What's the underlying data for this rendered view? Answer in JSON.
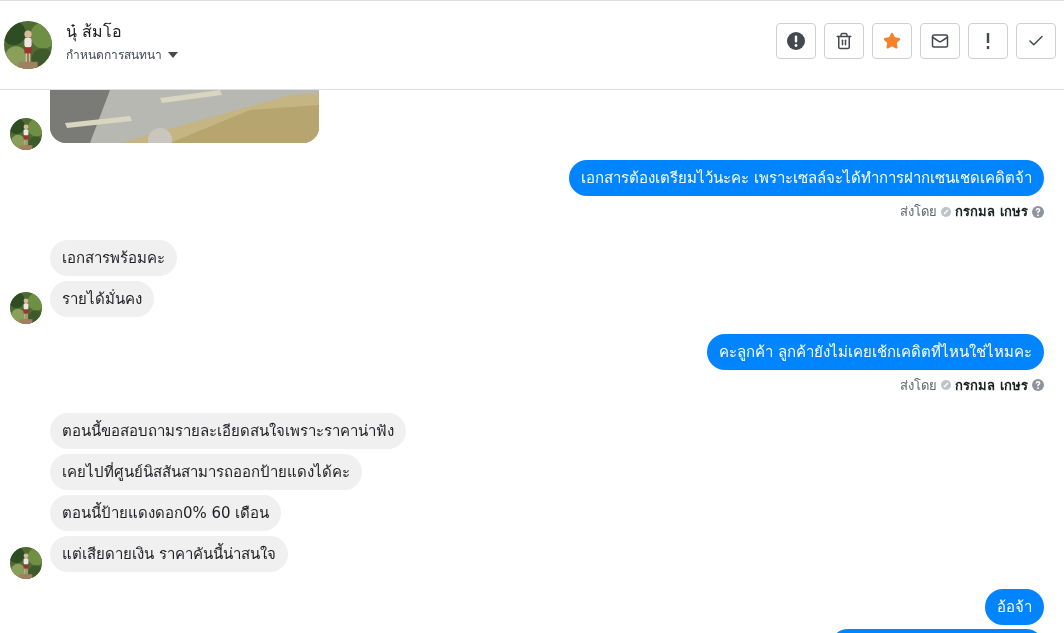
{
  "header": {
    "name": "นุ๋ ส้มโอ",
    "subtitle": "กำหนดการสนทนา"
  },
  "actions": [
    {
      "kind": "alert",
      "active": false
    },
    {
      "kind": "trash",
      "active": false
    },
    {
      "kind": "star",
      "active": true
    },
    {
      "kind": "mail",
      "active": false
    },
    {
      "kind": "bang",
      "active": false
    },
    {
      "kind": "check",
      "active": false
    }
  ],
  "groups": [
    {
      "kind": "incoming"
    },
    {
      "kind": "outgoing",
      "messages": [
        {
          "kind": "text",
          "text": "เอกสารต้องเตรียมไว้นะคะ เพราะเซลล์จะได้ทำการฝากเซนเชดเคดิตจ้า"
        }
      ],
      "sent_by": {
        "label": "ส่งโดย",
        "name": "กรกมล เกษร"
      }
    },
    {
      "kind": "incoming",
      "messages": [
        {
          "kind": "text",
          "text": "เอกสารพร้อมคะ"
        },
        {
          "kind": "text",
          "text": "รายได้มั่นคง"
        }
      ]
    },
    {
      "kind": "outgoing",
      "messages": [
        {
          "kind": "text",
          "text": "คะลูกค้า ลูกค้ายังไม่เคยเช้กเคดิตที่ไหนใช่ไหมคะ"
        }
      ],
      "sent_by": {
        "label": "ส่งโดย",
        "name": "กรกมล เกษร"
      }
    },
    {
      "kind": "incoming",
      "messages": [
        {
          "kind": "text",
          "text": "ตอนนี้ขอสอบถามรายละเอียดสนใจเพราะราคาน่าฟัง"
        },
        {
          "kind": "text",
          "text": "เคยไปที่ศูนย์นิสสันสามารถออกป้ายแดงได้คะ"
        },
        {
          "kind": "text",
          "text": "ตอนนี้ป้ายแดงดอก0% 60 เดือน"
        },
        {
          "kind": "text",
          "text": "แต่เสียดายเงิน ราคาคันนี้น่าสนใจ"
        }
      ]
    },
    {
      "kind": "outgoing",
      "messages": [
        {
          "kind": "text",
          "text": "อ้อจ้า"
        },
        {
          "kind": "cut"
        }
      ]
    }
  ]
}
